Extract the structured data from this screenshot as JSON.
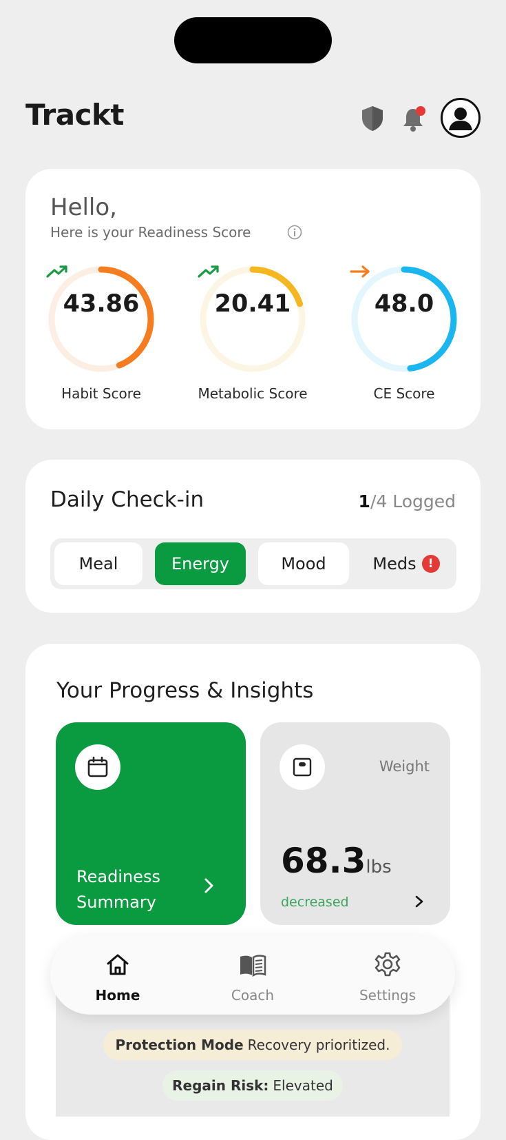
{
  "app": {
    "title": "Trackt"
  },
  "header": {
    "icons": [
      "shield-icon",
      "bell-icon",
      "profile-icon"
    ],
    "notification_color": "#e53935"
  },
  "readiness": {
    "greeting": "Hello,",
    "subtitle": "Here is your Readiness Score",
    "scores": [
      {
        "label": "Habit Score",
        "value": "43.86",
        "trend": "trending-up",
        "fraction": 0.44,
        "color": "#f57c1f",
        "track": "#fdeee3"
      },
      {
        "label": "Metabolic Score",
        "value": "20.41",
        "trend": "trending-up",
        "fraction": 0.2,
        "color": "#f5b61f",
        "track": "#fdf5e3"
      },
      {
        "label": "CE Score",
        "value": "48.0",
        "trend": "flat",
        "fraction": 0.48,
        "color": "#1ab6f0",
        "track": "#e3f6fd"
      }
    ]
  },
  "checkin": {
    "title": "Daily Check-in",
    "logged_count": "1",
    "logged_rest": "/4 Logged",
    "items": [
      {
        "label": "Meal",
        "state": "default"
      },
      {
        "label": "Energy",
        "state": "active"
      },
      {
        "label": "Mood",
        "state": "default"
      },
      {
        "label": "Meds",
        "state": "alert"
      }
    ],
    "alert_symbol": "!"
  },
  "progress": {
    "title": "Your Progress & Insights",
    "summary_line1": "Readiness",
    "summary_line2": "Summary",
    "weight": {
      "label": "Weight",
      "value": "68.3",
      "unit": "lbs",
      "status": "decreased"
    },
    "protection": {
      "bold": "Protection Mode",
      "text": "Recovery prioritized."
    },
    "regain": {
      "bold": "Regain Risk:",
      "text": "Elevated"
    }
  },
  "nav": {
    "items": [
      {
        "label": "Home",
        "icon": "home-icon",
        "active": true
      },
      {
        "label": "Coach",
        "icon": "book-icon",
        "active": false
      },
      {
        "label": "Settings",
        "icon": "gear-icon",
        "active": false
      }
    ]
  },
  "colors": {
    "brand_green": "#0a9a3f",
    "background": "#efeeef"
  }
}
